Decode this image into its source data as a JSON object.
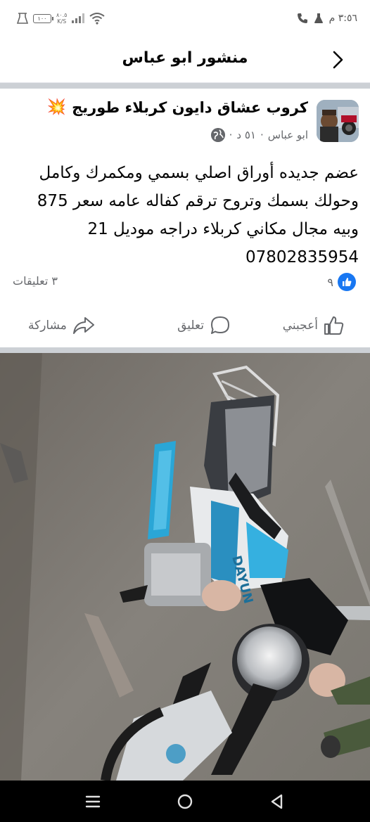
{
  "status_bar": {
    "time": "٣:٥٦ م",
    "battery": "١٠٠",
    "net_speed": "٨٠.٥",
    "net_unit": "K/S",
    "icons": [
      "phone-icon",
      "flask-icon",
      "wifi-icon",
      "signal-icon",
      "battery-icon",
      "lab-icon"
    ]
  },
  "header": {
    "title": "منشور ابو عباس",
    "back_icon": "chevron-right-icon"
  },
  "post": {
    "group_name": "كروب عشاق دايون كربلاء طوريج",
    "group_emoji": "💥",
    "author": "ابو عباس",
    "time": "٥١ د",
    "privacy_icon": "globe-icon",
    "text_lines": [
      "عضم جديده أوراق اصلي بسمي ومكمرك وكامل",
      "وحولك بسمك وتروح ترقم كفاله عامه سعر 875",
      "وبيه مجال مكاني كربلاء دراجه موديل 21",
      "07802835954"
    ],
    "likes": "٩",
    "comments": "٣ تعليقات"
  },
  "actions": {
    "like": "أعجبني",
    "comment": "تعليق",
    "share": "مشاركة"
  },
  "photo": {
    "brand_text": "DAYUN"
  },
  "colors": {
    "accent": "#1877f2",
    "muted": "#65676b",
    "separator": "#ccd0d5"
  }
}
